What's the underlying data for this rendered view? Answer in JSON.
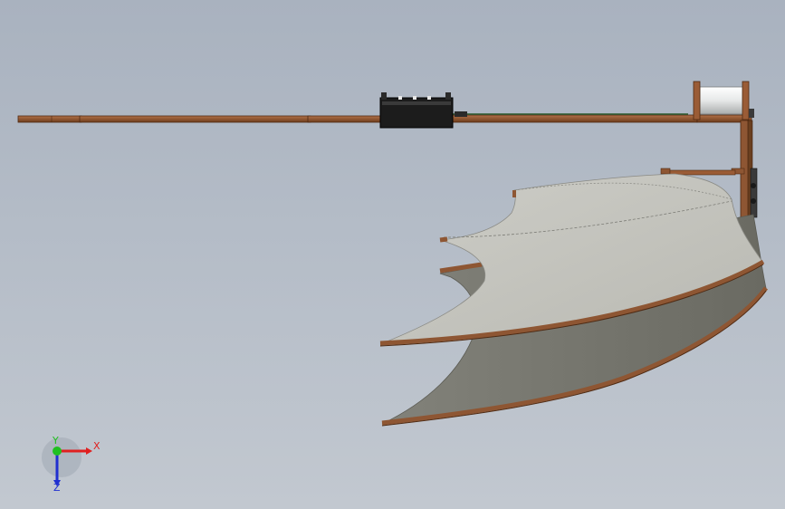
{
  "viewport": {
    "background_top": "#a9b2bf",
    "background_bottom": "#c2c8d0"
  },
  "model": {
    "wood_color": "#8e5633",
    "wood_dark": "#5a3216",
    "membrane_light": "#c4c4be",
    "membrane_shadow": "#74746a",
    "motor_color": "#1c1c1c",
    "spool_color": "#eceeee",
    "icons": [
      "rod-part",
      "motor-block",
      "spool-part",
      "wing-upper",
      "wing-lower",
      "gear-linkage"
    ]
  },
  "triad": {
    "x_label": "X",
    "y_label": "Y",
    "z_label": "Z",
    "x_color": "#e02020",
    "y_color": "#20c020",
    "z_color": "#2030d0"
  }
}
